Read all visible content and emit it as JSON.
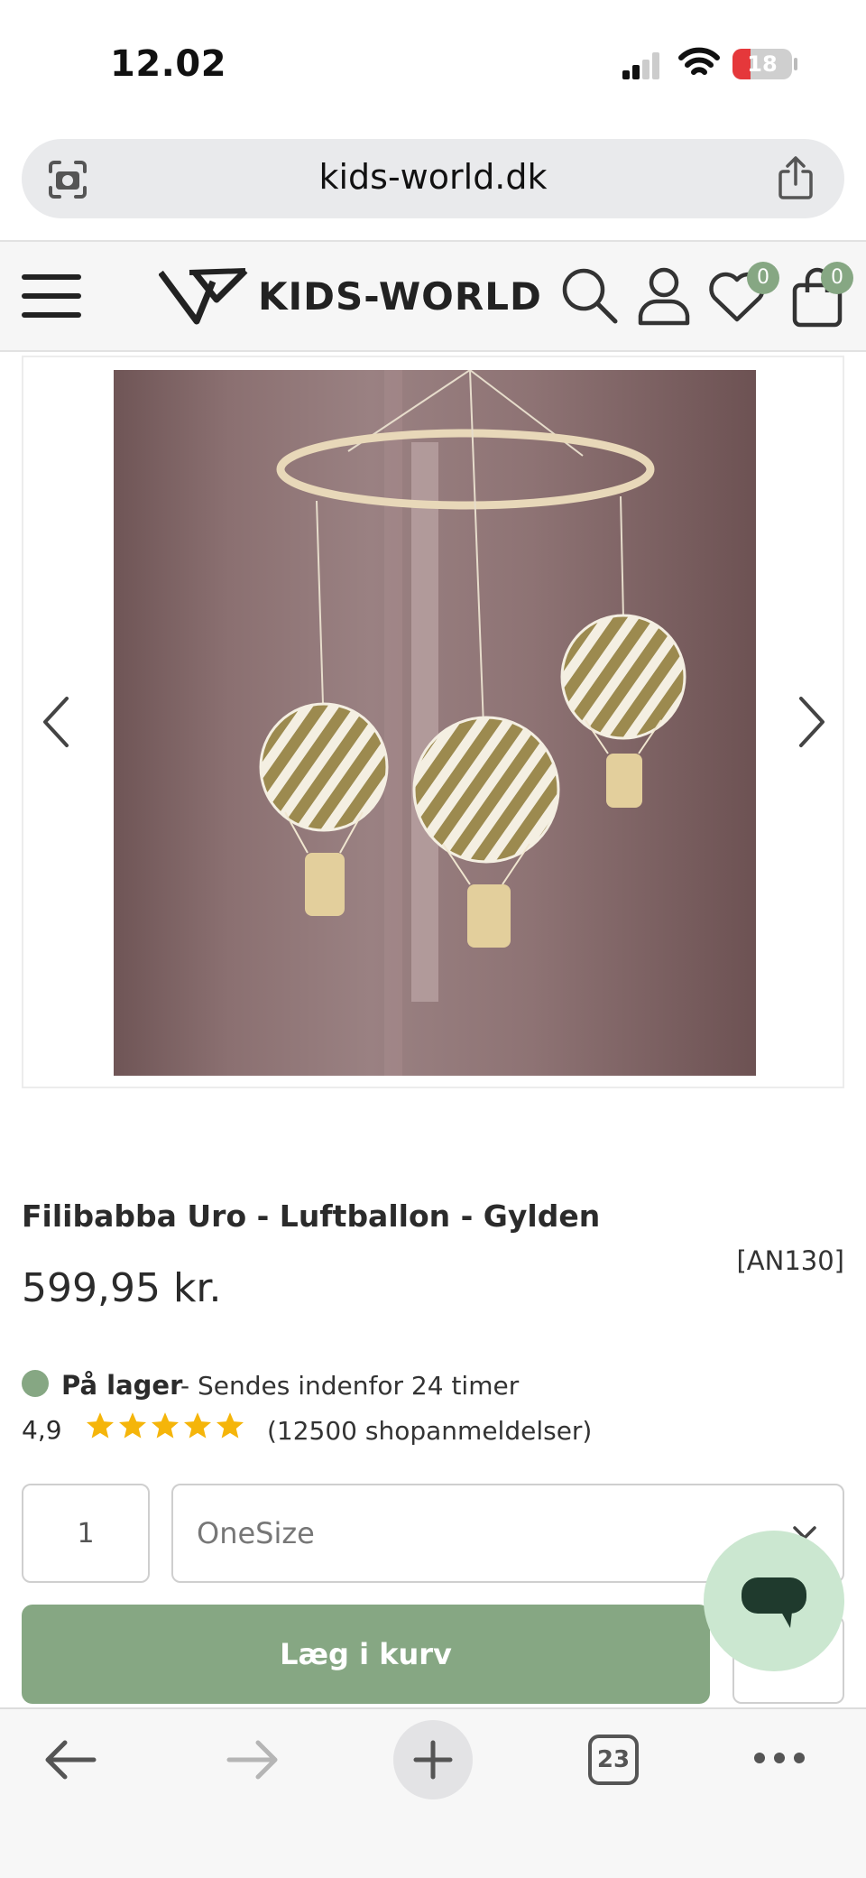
{
  "status_bar": {
    "time": "12.02",
    "battery_level": "18",
    "icons": [
      "cellular-signal-icon",
      "wifi-icon",
      "battery-icon"
    ],
    "battery_color": "#e5383b"
  },
  "browser": {
    "url": "kids-world.dk",
    "tabs_count": "23",
    "toolbar_icons": [
      "back-arrow-icon",
      "forward-arrow-icon",
      "new-tab-plus-icon",
      "tabs-icon",
      "more-icon"
    ]
  },
  "header": {
    "logo_text": "KIDS-WORLD",
    "wishlist_count": "0",
    "cart_count": "0",
    "icons": [
      "menu-icon",
      "search-icon",
      "account-icon",
      "heart-icon",
      "bag-icon"
    ],
    "accent_color": "#86a783"
  },
  "gallery": {
    "image_alt": "Hot air balloon mobile",
    "thumbnails": 2,
    "current_index": 2
  },
  "product": {
    "title": "Filibabba Uro - Luftballon - Gylden",
    "sku": "[AN130]",
    "price": "599,95 kr.",
    "stock_label": "På lager",
    "stock_note": "- Sendes indenfor 24 timer",
    "rating": "4,9",
    "rating_stars": 5,
    "review_count": "(12500 shopanmeldelser)",
    "quantity": "1",
    "size": "OneSize",
    "add_to_cart": "Læg i kurv"
  }
}
